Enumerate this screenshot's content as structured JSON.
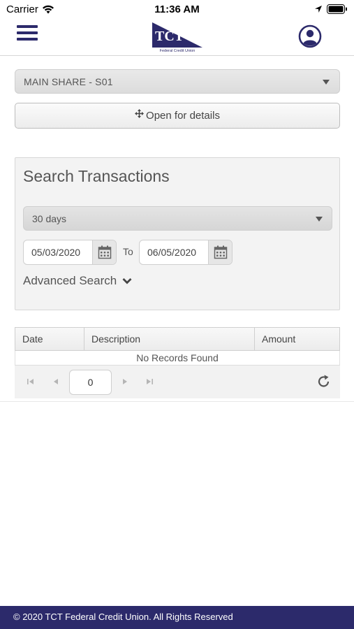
{
  "status_bar": {
    "carrier": "Carrier",
    "time": "11:36 AM"
  },
  "header": {
    "logo_text": "TCT",
    "logo_subtext": "Federal Credit Union",
    "brand_color": "#2c2a6b"
  },
  "account": {
    "selected": "MAIN SHARE - S01"
  },
  "details_button": {
    "label": "Open for details"
  },
  "search": {
    "title": "Search Transactions",
    "range_selected": "30 days",
    "from_date": "05/03/2020",
    "to_label": "To",
    "to_date": "06/05/2020",
    "advanced_label": "Advanced Search"
  },
  "table": {
    "columns": [
      "Date",
      "Description",
      "Amount"
    ],
    "empty_message": "No Records Found"
  },
  "pager": {
    "page": "0"
  },
  "footer": {
    "text": "© 2020 TCT Federal Credit Union. All Rights Reserved"
  }
}
